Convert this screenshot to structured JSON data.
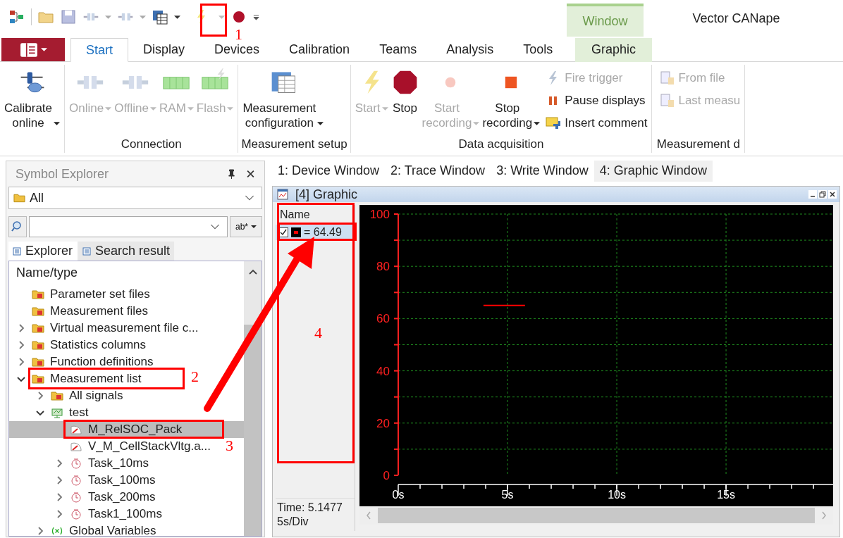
{
  "window": {
    "title": "Vector CANape"
  },
  "ribbon": {
    "contextual_group": "Window",
    "tabs": [
      {
        "label": "Start",
        "selected": true,
        "contextual": false
      },
      {
        "label": "Display",
        "selected": false,
        "contextual": false
      },
      {
        "label": "Devices",
        "selected": false,
        "contextual": false
      },
      {
        "label": "Calibration",
        "selected": false,
        "contextual": false
      },
      {
        "label": "Teams",
        "selected": false,
        "contextual": false
      },
      {
        "label": "Analysis",
        "selected": false,
        "contextual": false
      },
      {
        "label": "Tools",
        "selected": false,
        "contextual": false
      },
      {
        "label": "Graphic",
        "selected": false,
        "contextual": true
      }
    ],
    "groups": [
      {
        "items": [
          {
            "label": "Calibrate online",
            "kind": "large",
            "disabled": false,
            "dropdown": true
          }
        ]
      },
      {
        "label": "Connection",
        "items": [
          {
            "label": "Online",
            "kind": "large",
            "disabled": true,
            "dropdown": true
          },
          {
            "label": "Offline",
            "kind": "large",
            "disabled": true,
            "dropdown": true
          },
          {
            "label": "RAM",
            "kind": "large",
            "disabled": true,
            "dropdown": true
          },
          {
            "label": "Flash",
            "kind": "large",
            "disabled": true,
            "dropdown": true
          }
        ]
      },
      {
        "label": "Measurement setup",
        "items": [
          {
            "label": "Measurement configuration",
            "kind": "large",
            "disabled": false,
            "dropdown": true
          }
        ]
      },
      {
        "label": "Data acquisition",
        "items": [
          {
            "label": "Start",
            "kind": "large",
            "disabled": true,
            "dropdown": true
          },
          {
            "label": "Stop",
            "kind": "large",
            "disabled": false,
            "dropdown": false
          },
          {
            "label": "Start recording",
            "kind": "large",
            "disabled": true,
            "dropdown": true
          },
          {
            "label": "Stop recording",
            "kind": "large",
            "disabled": false,
            "dropdown": true
          },
          {
            "label": "Fire trigger",
            "kind": "small",
            "disabled": true
          },
          {
            "label": "Pause displays",
            "kind": "small",
            "disabled": false
          },
          {
            "label": "Insert comment",
            "kind": "small",
            "disabled": false
          }
        ]
      },
      {
        "label": "Measurement d",
        "items": [
          {
            "label": "From file",
            "kind": "small",
            "disabled": true
          },
          {
            "label": "Last measu",
            "kind": "small",
            "disabled": true
          }
        ]
      }
    ]
  },
  "symbol_explorer": {
    "title": "Symbol Explorer",
    "filter": {
      "value": "All"
    },
    "search": {
      "button": "ab*"
    },
    "tabs": [
      {
        "label": "Explorer",
        "selected": true
      },
      {
        "label": "Search result",
        "selected": false
      }
    ],
    "column": "Name/type",
    "tree": [
      {
        "label": "Parameter set files",
        "kind": "folder",
        "expandable": false,
        "selected": false
      },
      {
        "label": "Measurement files",
        "kind": "folder",
        "expandable": false,
        "selected": false
      },
      {
        "label": "Virtual measurement file c...",
        "kind": "folder",
        "expandable": true,
        "expanded": false,
        "selected": false
      },
      {
        "label": "Statistics columns",
        "kind": "folder",
        "expandable": true,
        "expanded": false,
        "selected": false
      },
      {
        "label": "Function definitions",
        "kind": "folder",
        "expandable": true,
        "expanded": false,
        "selected": false
      },
      {
        "label": "Measurement list",
        "kind": "folder",
        "expandable": true,
        "expanded": true,
        "selected": false,
        "children": [
          {
            "label": "All signals",
            "kind": "folder",
            "expandable": true,
            "expanded": false,
            "selected": false
          },
          {
            "label": "test",
            "kind": "group",
            "expandable": true,
            "expanded": true,
            "selected": false,
            "children": [
              {
                "label": "M_RelSOC_Pack",
                "kind": "signal",
                "expandable": false,
                "selected": true
              },
              {
                "label": "V_M_CellStackVltg.a...",
                "kind": "signal",
                "expandable": false,
                "selected": false
              },
              {
                "label": "Task_10ms",
                "kind": "task",
                "expandable": true,
                "expanded": false,
                "selected": false
              },
              {
                "label": "Task_100ms",
                "kind": "task",
                "expandable": true,
                "expanded": false,
                "selected": false
              },
              {
                "label": "Task_200ms",
                "kind": "task",
                "expandable": true,
                "expanded": false,
                "selected": false
              },
              {
                "label": "Task1_100ms",
                "kind": "task",
                "expandable": true,
                "expanded": false,
                "selected": false
              }
            ]
          },
          {
            "label": "Global Variables",
            "kind": "variables",
            "expandable": true,
            "expanded": false,
            "selected": false
          }
        ]
      }
    ]
  },
  "document_tabs": [
    {
      "label": "1: Device Window",
      "selected": false
    },
    {
      "label": "2: Trace Window",
      "selected": false
    },
    {
      "label": "3: Write Window",
      "selected": false
    },
    {
      "label": "4: Graphic Window",
      "selected": true
    }
  ],
  "graphic_window": {
    "title": "[4] Graphic",
    "legend": {
      "header": "Name",
      "signals": [
        {
          "checked": true,
          "color": "#ff0000",
          "value": "= 64.49",
          "selected": true
        }
      ]
    },
    "time": "Time: 5.1477",
    "scale": "5s/Div",
    "chart_data": {
      "type": "line",
      "x": [
        3.9,
        5.8
      ],
      "series": [
        {
          "color": "#ff0000",
          "values": [
            65,
            65
          ]
        }
      ],
      "xlim": [
        0,
        19.9
      ],
      "ylim": [
        0,
        100
      ],
      "xticks": [
        {
          "value": 0,
          "label": "0s"
        },
        {
          "value": 5,
          "label": "5s"
        },
        {
          "value": 10,
          "label": "10s"
        },
        {
          "value": 15,
          "label": "15s"
        }
      ],
      "yticks": [
        0,
        20,
        40,
        60,
        80,
        100
      ],
      "grid": true
    }
  },
  "annotations": [
    {
      "label": "1"
    },
    {
      "label": "2"
    },
    {
      "label": "3"
    },
    {
      "label": "4"
    }
  ]
}
